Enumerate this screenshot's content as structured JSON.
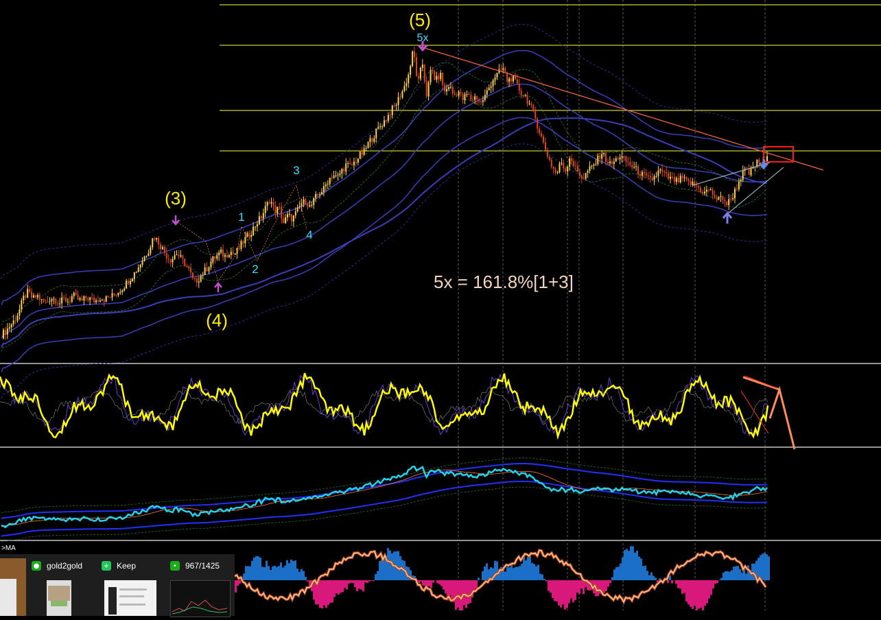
{
  "chart_data": {
    "type": "line",
    "title": "",
    "xlabel": "",
    "ylabel": "",
    "grid": false,
    "wave_labels": [
      {
        "name": "wave-3-major",
        "text": "(3)"
      },
      {
        "name": "wave-4-major",
        "text": "(4)"
      },
      {
        "name": "wave-5-major",
        "text": "(5)"
      },
      {
        "name": "wave-5x-marker",
        "text": "5x"
      },
      {
        "name": "subwave-1",
        "text": "1"
      },
      {
        "name": "subwave-2",
        "text": "2"
      },
      {
        "name": "subwave-3",
        "text": "3"
      },
      {
        "name": "subwave-4",
        "text": "4"
      }
    ],
    "annotation": "5x = 161.8%[1+3]",
    "indicator_label": ">MA",
    "series": [
      {
        "values": [
          0.02,
          0.04,
          0.07,
          0.1,
          0.15,
          0.22,
          0.25,
          0.21,
          0.23,
          0.2,
          0.19,
          0.22,
          0.21,
          0.19,
          0.21,
          0.2,
          0.23,
          0.21,
          0.2,
          0.22,
          0.21,
          0.2,
          0.22,
          0.21,
          0.22,
          0.23,
          0.25,
          0.27,
          0.3,
          0.33,
          0.36,
          0.4,
          0.44,
          0.48,
          0.55,
          0.52,
          0.48,
          0.44,
          0.42,
          0.46,
          0.43,
          0.4,
          0.36,
          0.3,
          0.32,
          0.35,
          0.38,
          0.42,
          0.44,
          0.46,
          0.44,
          0.47,
          0.45,
          0.48,
          0.52,
          0.55,
          0.58,
          0.62,
          0.65,
          0.7,
          0.75,
          0.68,
          0.7,
          0.62,
          0.66,
          0.64,
          0.68,
          0.72,
          0.74,
          0.7,
          0.75,
          0.78,
          0.8,
          0.85,
          0.88,
          0.86,
          0.9,
          0.93,
          0.92,
          0.95,
          0.98,
          1.0,
          1.05,
          1.08,
          1.12,
          1.15,
          1.18,
          1.22,
          1.25,
          1.3,
          1.35,
          1.42,
          1.55,
          1.36,
          1.48,
          1.3,
          1.45,
          1.38,
          1.42,
          1.32,
          1.36,
          1.3,
          1.33,
          1.28,
          1.31,
          1.28,
          1.3,
          1.26,
          1.3,
          1.35,
          1.4,
          1.42,
          1.45,
          1.38,
          1.4,
          1.36,
          1.32,
          1.3,
          1.25,
          1.2,
          1.12,
          1.05,
          0.98,
          0.92,
          0.88,
          0.95,
          0.9,
          0.98,
          0.92,
          0.88,
          0.86,
          0.9,
          0.92,
          0.95,
          1.0,
          0.96,
          0.93,
          0.95,
          0.98,
          0.96,
          0.94,
          0.92,
          0.9,
          0.88,
          0.86,
          0.85,
          0.87,
          0.9,
          0.88,
          0.86,
          0.85,
          0.84,
          0.86,
          0.84,
          0.83,
          0.82,
          0.8,
          0.78,
          0.8,
          0.77,
          0.74,
          0.76,
          0.72,
          0.75,
          0.8,
          0.86,
          0.9,
          0.88,
          0.92,
          0.95,
          0.93,
          0.96
        ]
      }
    ]
  },
  "taskbar": {
    "apps": [
      {
        "label": "gold2gold",
        "icon": "people-icon",
        "color": "#1aad19"
      },
      {
        "label": "Keep",
        "icon": "keep-icon",
        "color": "#24c45a"
      },
      {
        "label": "967/1425",
        "icon": "chat-icon",
        "color": "#1aad19"
      }
    ]
  },
  "colors": {
    "background": "#000000",
    "bull_candle": "#ffd24a",
    "bear_candle": "#e0451b",
    "bollinger": "#3a3fb8",
    "ema_dashed": "#2e7d32",
    "fib_level": "#ffff33",
    "trendline": "#ff6a3d",
    "target_box": "#ff1a1a",
    "oscillator": "#ffff00",
    "oscillator_signal": "#6a3dd1",
    "rsi_line": "#22d3ee",
    "hist_positive": "#1b6fc7",
    "hist_negative": "#d8187a",
    "stoch_line": "#ffcc99"
  }
}
